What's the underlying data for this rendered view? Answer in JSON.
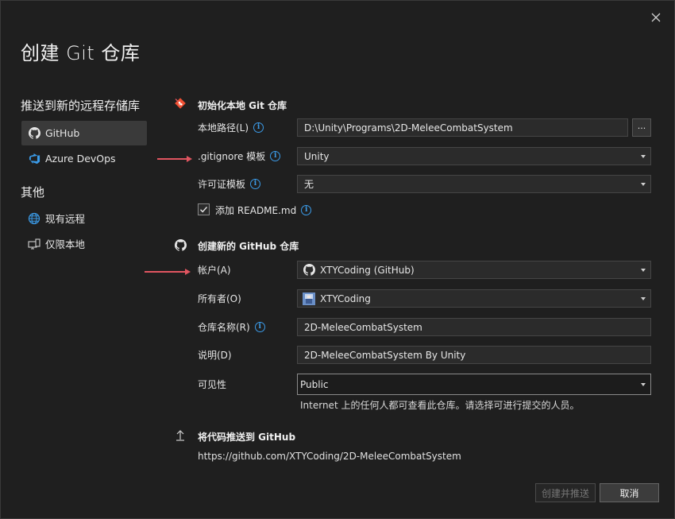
{
  "dialog": {
    "title": "创建 Git 仓库",
    "close_icon": "close-icon"
  },
  "sidebar": {
    "heading_push": "推送到新的远程存储库",
    "push_items": [
      {
        "label": "GitHub",
        "icon": "github-icon",
        "active": true
      },
      {
        "label": "Azure DevOps",
        "icon": "azure-devops-icon",
        "active": false
      }
    ],
    "heading_other": "其他",
    "other_items": [
      {
        "label": "现有远程",
        "icon": "globe-icon"
      },
      {
        "label": "仅限本地",
        "icon": "local-computer-icon"
      }
    ]
  },
  "local": {
    "heading": "初始化本地 Git 仓库",
    "path_label": "本地路径(L)",
    "path_value": "D:\\Unity\\Programs\\2D-MeleeCombatSystem",
    "browse_label": "...",
    "gitignore_label": ".gitignore 模板",
    "gitignore_value": "Unity",
    "license_label": "许可证模板",
    "license_value": "无",
    "readme_label": "添加 README.md",
    "readme_checked": true
  },
  "github": {
    "heading": "创建新的 GitHub 仓库",
    "account_label": "帐户(A)",
    "account_value": "XTYCoding (GitHub)",
    "owner_label": "所有者(O)",
    "owner_value": "XTYCoding",
    "repo_label": "仓库名称(R)",
    "repo_value": "2D-MeleeCombatSystem",
    "desc_label": "说明(D)",
    "desc_value": "2D-MeleeCombatSystem By Unity",
    "visibility_label": "可见性",
    "visibility_value": "Public",
    "visibility_hint": "Internet 上的任何人都可查看此仓库。请选择可进行提交的人员。"
  },
  "push": {
    "heading": "将代码推送到 GitHub",
    "url": "https://github.com/XTYCoding/2D-MeleeCombatSystem"
  },
  "footer": {
    "create_label": "创建并推送",
    "cancel_label": "取消"
  },
  "colors": {
    "accent_info": "#3b9be8",
    "annotation_arrow": "#e05560",
    "git_icon": "#f05033"
  }
}
